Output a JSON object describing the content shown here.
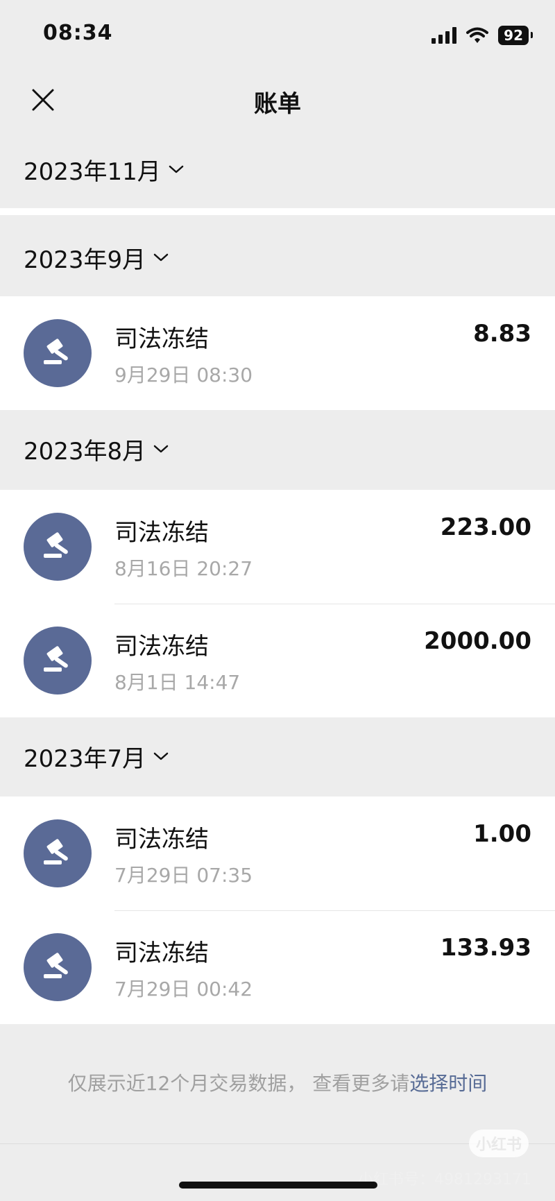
{
  "status": {
    "time": "08:34",
    "battery": "92"
  },
  "nav": {
    "title": "账单"
  },
  "months": [
    {
      "label": "2023年11月",
      "items": []
    },
    {
      "label": "2023年9月",
      "items": [
        {
          "title": "司法冻结",
          "time": "9月29日 08:30",
          "amount": "8.83"
        }
      ]
    },
    {
      "label": "2023年8月",
      "items": [
        {
          "title": "司法冻结",
          "time": "8月16日 20:27",
          "amount": "223.00"
        },
        {
          "title": "司法冻结",
          "time": "8月1日 14:47",
          "amount": "2000.00"
        }
      ]
    },
    {
      "label": "2023年7月",
      "items": [
        {
          "title": "司法冻结",
          "time": "7月29日 07:35",
          "amount": "1.00"
        },
        {
          "title": "司法冻结",
          "time": "7月29日 00:42",
          "amount": "133.93"
        }
      ]
    }
  ],
  "footer": {
    "note": "仅展示近12个月交易数据， 查看更多请",
    "link": "选择时间"
  },
  "watermark": {
    "badge": "小红书",
    "text": "小红书号：4981293171"
  },
  "icons": {
    "close": "close-icon",
    "chevron": "chevron-down-icon",
    "gavel": "gavel-icon"
  },
  "colors": {
    "background": "#ededed",
    "avatar": "#5a6a96",
    "link": "#576b95"
  }
}
